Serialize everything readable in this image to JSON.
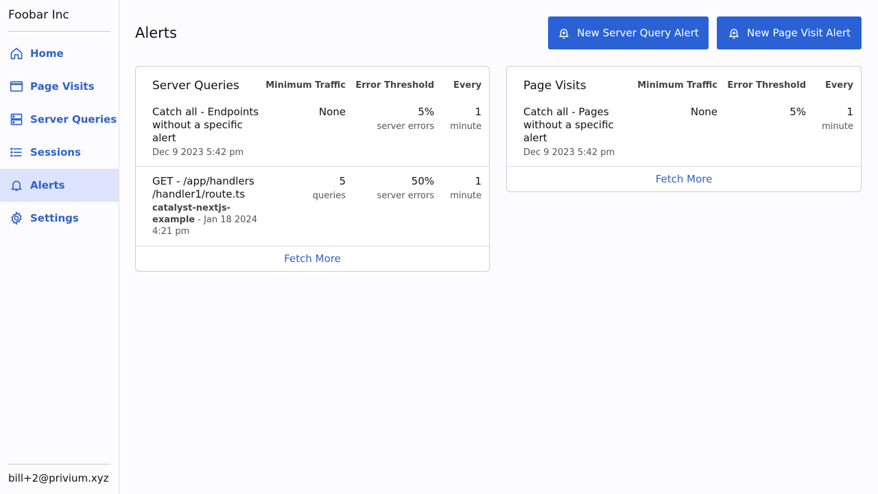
{
  "sidebar": {
    "org_name": "Foobar Inc",
    "items": [
      {
        "label": "Home",
        "icon": "home-icon"
      },
      {
        "label": "Page Visits",
        "icon": "browser-window-icon"
      },
      {
        "label": "Server Queries",
        "icon": "server-icon"
      },
      {
        "label": "Sessions",
        "icon": "list-icon"
      },
      {
        "label": "Alerts",
        "icon": "bell-icon",
        "active": true
      },
      {
        "label": "Settings",
        "icon": "gear-icon"
      }
    ],
    "user_email": "bill+2@privium.xyz"
  },
  "header": {
    "title": "Alerts",
    "new_server_query_alert": "New Server Query Alert",
    "new_page_visit_alert": "New Page Visit Alert"
  },
  "colors": {
    "accent": "#2a62d6",
    "link": "#2f62c8",
    "active_nav_bg": "#dce3fb"
  },
  "server_queries": {
    "title": "Server Queries",
    "columns": [
      "Minimum Traffic",
      "Error Threshold",
      "Every"
    ],
    "rows": [
      {
        "name_line1": "Catch all - Endpoints",
        "name_line2": "without a specific",
        "name_line3": "alert",
        "date": "Dec 9 2023 5:42 pm",
        "min_traffic": "None",
        "min_traffic_unit": "",
        "error_threshold": "5%",
        "error_unit": "server errors",
        "every": "1",
        "every_unit": "minute"
      },
      {
        "name_line1": "GET - /app/handlers",
        "name_line2": "/handler1/route.ts",
        "project_line1": "catalyst-nextjs-",
        "project_line2": "example",
        "date_line1": " - Jan 18 2024",
        "date_line2": "4:21 pm",
        "min_traffic": "5",
        "min_traffic_unit": "queries",
        "error_threshold": "50%",
        "error_unit": "server errors",
        "every": "1",
        "every_unit": "minute"
      }
    ],
    "fetch_more": "Fetch More"
  },
  "page_visits": {
    "title": "Page Visits",
    "columns": [
      "Minimum Traffic",
      "Error Threshold",
      "Every"
    ],
    "rows": [
      {
        "name_line1": "Catch all - Pages",
        "name_line2": "without a specific",
        "name_line3": "alert",
        "date": "Dec 9 2023 5:42 pm",
        "min_traffic": "None",
        "error_threshold": "5%",
        "every": "1",
        "every_unit": "minute"
      }
    ],
    "fetch_more": "Fetch More"
  }
}
